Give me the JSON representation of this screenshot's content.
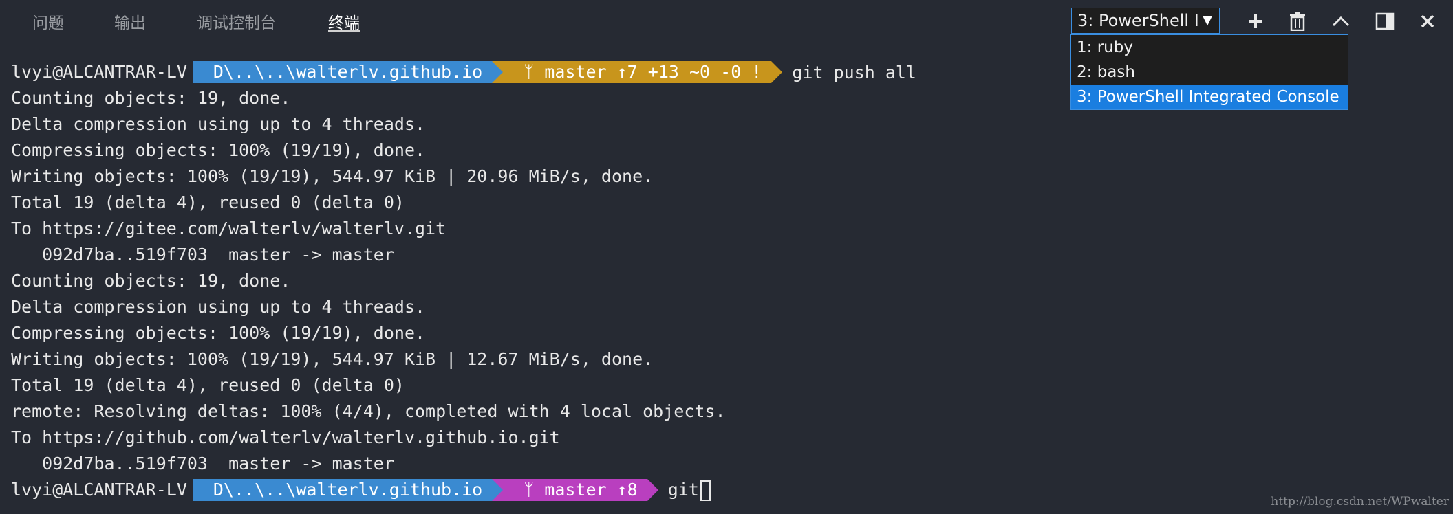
{
  "panel": {
    "tabs": [
      {
        "label": "问题"
      },
      {
        "label": "输出"
      },
      {
        "label": "调试控制台"
      },
      {
        "label": "终端"
      }
    ],
    "active_tab": "终端"
  },
  "terminal_selector": {
    "value": "3: PowerShell I",
    "options": [
      {
        "label": "1: ruby"
      },
      {
        "label": "2: bash"
      },
      {
        "label": "3: PowerShell Integrated Console"
      }
    ],
    "selected_index": 2
  },
  "toolbar": {
    "icons": [
      "plus-icon",
      "trash-icon",
      "chevron-up-icon",
      "split-panel-icon",
      "close-icon"
    ]
  },
  "terminal": {
    "prompt1": {
      "user": "lvyi@ALCANTRAR-LV",
      "path": "D\\..\\..\\walterlv.github.io",
      "git": "ᛘ master ↑7 +13 ~0 -0 !",
      "git_color": "#c8951c",
      "command": "git push all"
    },
    "output": [
      "Counting objects: 19, done.",
      "Delta compression using up to 4 threads.",
      "Compressing objects: 100% (19/19), done.",
      "Writing objects: 100% (19/19), 544.97 KiB | 20.96 MiB/s, done.",
      "Total 19 (delta 4), reused 0 (delta 0)",
      "To https://gitee.com/walterlv/walterlv.git",
      "   092d7ba..519f703  master -> master",
      "Counting objects: 19, done.",
      "Delta compression using up to 4 threads.",
      "Compressing objects: 100% (19/19), done.",
      "Writing objects: 100% (19/19), 544.97 KiB | 12.67 MiB/s, done.",
      "Total 19 (delta 4), reused 0 (delta 0)",
      "remote: Resolving deltas: 100% (4/4), completed with 4 local objects.",
      "To https://github.com/walterlv/walterlv.github.io.git",
      "   092d7ba..519f703  master -> master"
    ],
    "prompt2": {
      "user": "lvyi@ALCANTRAR-LV",
      "path": "D\\..\\..\\walterlv.github.io",
      "git": "ᛘ master ↑8",
      "git_color": "#b93fbf",
      "command": "git"
    },
    "path_color": "#3a8ad1"
  },
  "watermark": "http://blog.csdn.net/WPwalter"
}
